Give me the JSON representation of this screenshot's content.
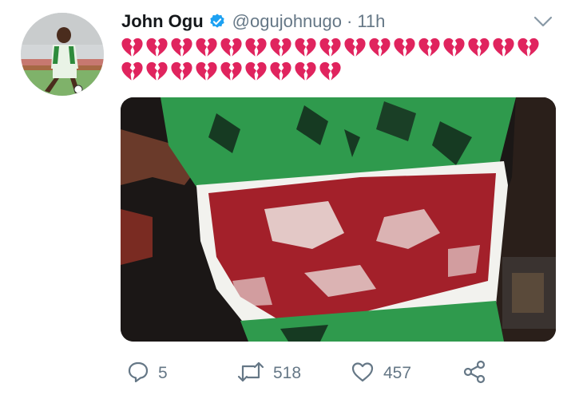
{
  "tweet": {
    "display_name": "John Ogu",
    "handle": "@ogujohnugo",
    "separator": "·",
    "time": "11h",
    "heart_count_row1": 17,
    "heart_count_row2": 9,
    "text_emoji": "broken-heart-icon"
  },
  "actions": {
    "reply_count": "5",
    "retweet_count": "518",
    "like_count": "457"
  },
  "colors": {
    "verified": "#1da1f2",
    "heart": "#e0245e",
    "muted": "#657786"
  }
}
